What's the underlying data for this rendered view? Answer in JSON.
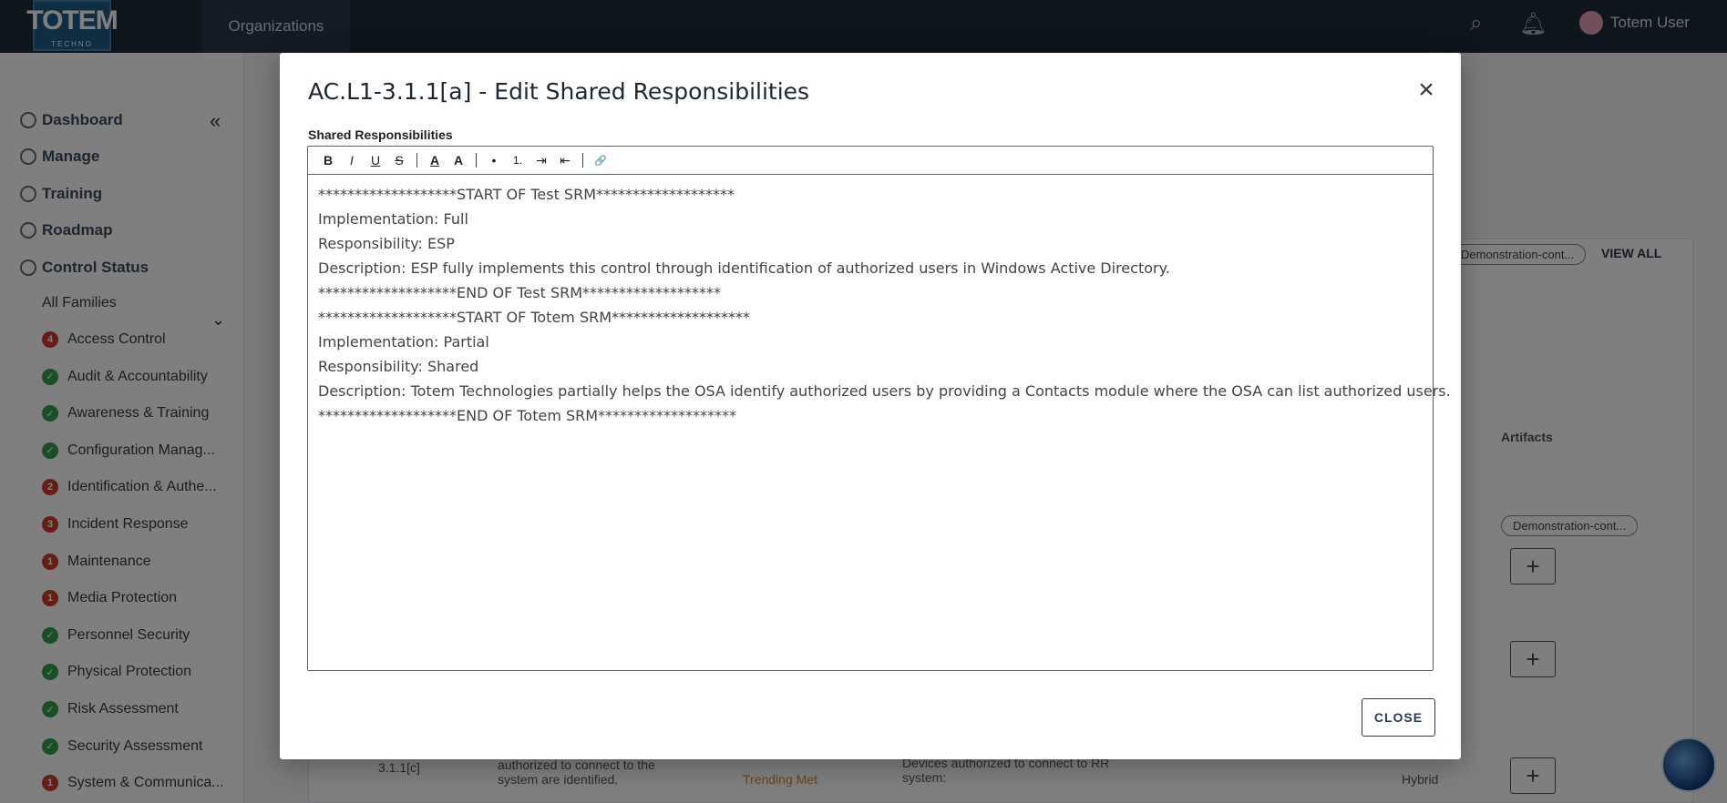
{
  "app": {
    "logo_text": "TOTEM",
    "logo_sub": "TECHNO",
    "org_tab": "Organizations",
    "user_name": "Totem User"
  },
  "sidebar": {
    "nav": [
      {
        "label": "Dashboard",
        "icon": "dashboard-icon"
      },
      {
        "label": "Manage",
        "icon": "gear-icon"
      },
      {
        "label": "Training",
        "icon": "training-icon"
      },
      {
        "label": "Roadmap",
        "icon": "map-icon"
      },
      {
        "label": "Control Status",
        "icon": "check-icon"
      }
    ],
    "all_families": "All Families",
    "families": [
      {
        "label": "Access Control",
        "badge": "4",
        "status": "red"
      },
      {
        "label": "Audit & Accountability",
        "badge": "✓",
        "status": "green"
      },
      {
        "label": "Awareness & Training",
        "badge": "✓",
        "status": "green"
      },
      {
        "label": "Configuration Manag...",
        "badge": "✓",
        "status": "green"
      },
      {
        "label": "Identification & Authe...",
        "badge": "2",
        "status": "red"
      },
      {
        "label": "Incident Response",
        "badge": "3",
        "status": "red"
      },
      {
        "label": "Maintenance",
        "badge": "1",
        "status": "red"
      },
      {
        "label": "Media Protection",
        "badge": "1",
        "status": "red"
      },
      {
        "label": "Personnel Security",
        "badge": "✓",
        "status": "green"
      },
      {
        "label": "Physical Protection",
        "badge": "✓",
        "status": "green"
      },
      {
        "label": "Risk Assessment",
        "badge": "✓",
        "status": "green"
      },
      {
        "label": "Security Assessment",
        "badge": "✓",
        "status": "green"
      },
      {
        "label": "System & Communica...",
        "badge": "1",
        "status": "red"
      }
    ]
  },
  "background": {
    "view_all": "VIEW ALL",
    "artifacts_header": "Artifacts",
    "artifact_pill_1": "Demonstration-cont...",
    "artifact_pill_2": "Demonstration-cont...",
    "row_id": "3.1.1[c]",
    "row_text": "authorized to connect to the system are identified.",
    "row_status": "Trending Met",
    "row_desc": "Devices authorized to connect to RR system:",
    "row_type": "Hybrid"
  },
  "modal": {
    "title": "AC.L1-3.1.1[a] - Edit Shared Responsibilities",
    "field_label": "Shared Responsibilities",
    "close_label": "CLOSE",
    "toolbar": {
      "bold": "B",
      "italic": "I",
      "underline": "U",
      "strike": "S",
      "font_color": "A",
      "highlight": "A",
      "bullet": "•",
      "numbered": "1.",
      "indent": "⇥",
      "outdent": "⇤",
      "link": "🔗"
    },
    "lines": [
      "*******************START OF Test SRM*******************",
      "Implementation: Full",
      "Responsibility: ESP",
      "Description: ESP fully implements this control through identification of authorized users in Windows Active Directory.",
      "*******************END OF Test SRM*******************",
      "*******************START OF Totem SRM*******************",
      "Implementation: Partial",
      "Responsibility: Shared",
      "Description: Totem Technologies partially helps the OSA identify authorized users by providing a Contacts module where the OSA can list authorized users.",
      "*******************END OF Totem SRM*******************"
    ]
  }
}
